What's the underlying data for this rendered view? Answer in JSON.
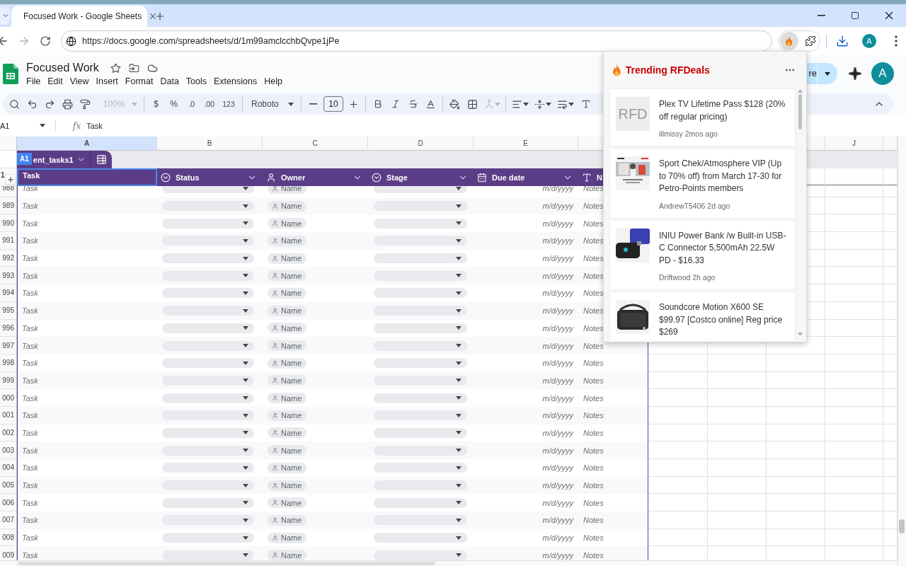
{
  "browser": {
    "tab_title": "Focused Work - Google Sheets",
    "address": "https://docs.google.com/spreadsheets/d/1m99amclcchbQvpe1jPe",
    "forward_disabled": true,
    "extension_active": true,
    "profile": "A"
  },
  "doc": {
    "title": "Focused Work",
    "menu": [
      "File",
      "Edit",
      "View",
      "Insert",
      "Format",
      "Data",
      "Tools",
      "Extensions",
      "Help"
    ],
    "share_label": "re",
    "avatar": "A"
  },
  "toolbar": {
    "zoom": "100%",
    "zoom_disabled": true,
    "currency": "$",
    "percent": "%",
    "decrease_decimals": ".0",
    "increase_decimals": ".00",
    "number_format": "123",
    "font": "Roboto",
    "font_size": "10",
    "merge_disabled": true
  },
  "formula_bar": {
    "cell": "A1",
    "fx": "fx",
    "content": "Task"
  },
  "grid": {
    "column_headers": [
      {
        "letter": "A",
        "selected": true
      },
      {
        "letter": "B",
        "selected": false
      },
      {
        "letter": "C",
        "selected": false
      },
      {
        "letter": "D",
        "selected": false
      },
      {
        "letter": "E",
        "selected": false
      },
      {
        "letter": "J",
        "selected": false
      }
    ]
  },
  "table": {
    "cell_badge": "A1",
    "name": "ent_tasks1",
    "header_row_number": "1",
    "columns": [
      {
        "label": "Task",
        "kind": "title",
        "selected": true
      },
      {
        "label": "Status",
        "kind": "dropdown",
        "selected": false
      },
      {
        "label": "Owner",
        "kind": "person",
        "selected": false
      },
      {
        "label": "Stage",
        "kind": "dropdown",
        "selected": false
      },
      {
        "label": "Due date",
        "kind": "date",
        "selected": false
      },
      {
        "label": "N",
        "kind": "text",
        "selected": false
      }
    ],
    "rows": [
      {
        "number": "988",
        "task": "Task",
        "owner": "Name",
        "due": "m/d/yyyy",
        "notes": "Notes"
      },
      {
        "number": "989",
        "task": "Task",
        "owner": "Name",
        "due": "m/d/yyyy",
        "notes": "Notes"
      },
      {
        "number": "990",
        "task": "Task",
        "owner": "Name",
        "due": "m/d/yyyy",
        "notes": "Notes"
      },
      {
        "number": "991",
        "task": "Task",
        "owner": "Name",
        "due": "m/d/yyyy",
        "notes": "Notes"
      },
      {
        "number": "992",
        "task": "Task",
        "owner": "Name",
        "due": "m/d/yyyy",
        "notes": "Notes"
      },
      {
        "number": "993",
        "task": "Task",
        "owner": "Name",
        "due": "m/d/yyyy",
        "notes": "Notes"
      },
      {
        "number": "994",
        "task": "Task",
        "owner": "Name",
        "due": "m/d/yyyy",
        "notes": "Notes"
      },
      {
        "number": "995",
        "task": "Task",
        "owner": "Name",
        "due": "m/d/yyyy",
        "notes": "Notes"
      },
      {
        "number": "996",
        "task": "Task",
        "owner": "Name",
        "due": "m/d/yyyy",
        "notes": "Notes"
      },
      {
        "number": "997",
        "task": "Task",
        "owner": "Name",
        "due": "m/d/yyyy",
        "notes": "Notes"
      },
      {
        "number": "998",
        "task": "Task",
        "owner": "Name",
        "due": "m/d/yyyy",
        "notes": "Notes"
      },
      {
        "number": "999",
        "task": "Task",
        "owner": "Name",
        "due": "m/d/yyyy",
        "notes": "Notes"
      },
      {
        "number": "000",
        "task": "Task",
        "owner": "Name",
        "due": "m/d/yyyy",
        "notes": "Notes"
      },
      {
        "number": "001",
        "task": "Task",
        "owner": "Name",
        "due": "m/d/yyyy",
        "notes": "Notes"
      },
      {
        "number": "002",
        "task": "Task",
        "owner": "Name",
        "due": "m/d/yyyy",
        "notes": "Notes"
      },
      {
        "number": "003",
        "task": "Task",
        "owner": "Name",
        "due": "m/d/yyyy",
        "notes": "Notes"
      },
      {
        "number": "004",
        "task": "Task",
        "owner": "Name",
        "due": "m/d/yyyy",
        "notes": "Notes"
      },
      {
        "number": "005",
        "task": "Task",
        "owner": "Name",
        "due": "m/d/yyyy",
        "notes": "Notes"
      },
      {
        "number": "006",
        "task": "Task",
        "owner": "Name",
        "due": "m/d/yyyy",
        "notes": "Notes"
      },
      {
        "number": "007",
        "task": "Task",
        "owner": "Name",
        "due": "m/d/yyyy",
        "notes": "Notes"
      },
      {
        "number": "008",
        "task": "Task",
        "owner": "Name",
        "due": "m/d/yyyy",
        "notes": "Notes"
      },
      {
        "number": "009",
        "task": "Task",
        "owner": "Name",
        "due": "m/d/yyyy",
        "notes": "Notes"
      }
    ]
  },
  "popup": {
    "title": "Trending RFDeals",
    "deals": [
      {
        "kind": "placeholder",
        "thumb": "RFD",
        "title": "Plex TV Lifetime Pass $128 (20% off regular pricing)",
        "meta": "lilmissy 2mos ago"
      },
      {
        "kind": "picture",
        "title": "Sport Chek/Atmosphere VIP (Up to 70% off) from March 17-30 for Petro-Points members",
        "meta": "AndrewT5406 2d ago"
      },
      {
        "kind": "picture",
        "title": "INIU Power Bank /w Built-in USB-C Connector 5,500mAh 22.5W PD - $16.33",
        "meta": "Driftwood 2h ago"
      },
      {
        "kind": "picture",
        "title": "Soundcore Motion X600 SE $99.97 [Costco online] Reg price $269"
      }
    ]
  }
}
